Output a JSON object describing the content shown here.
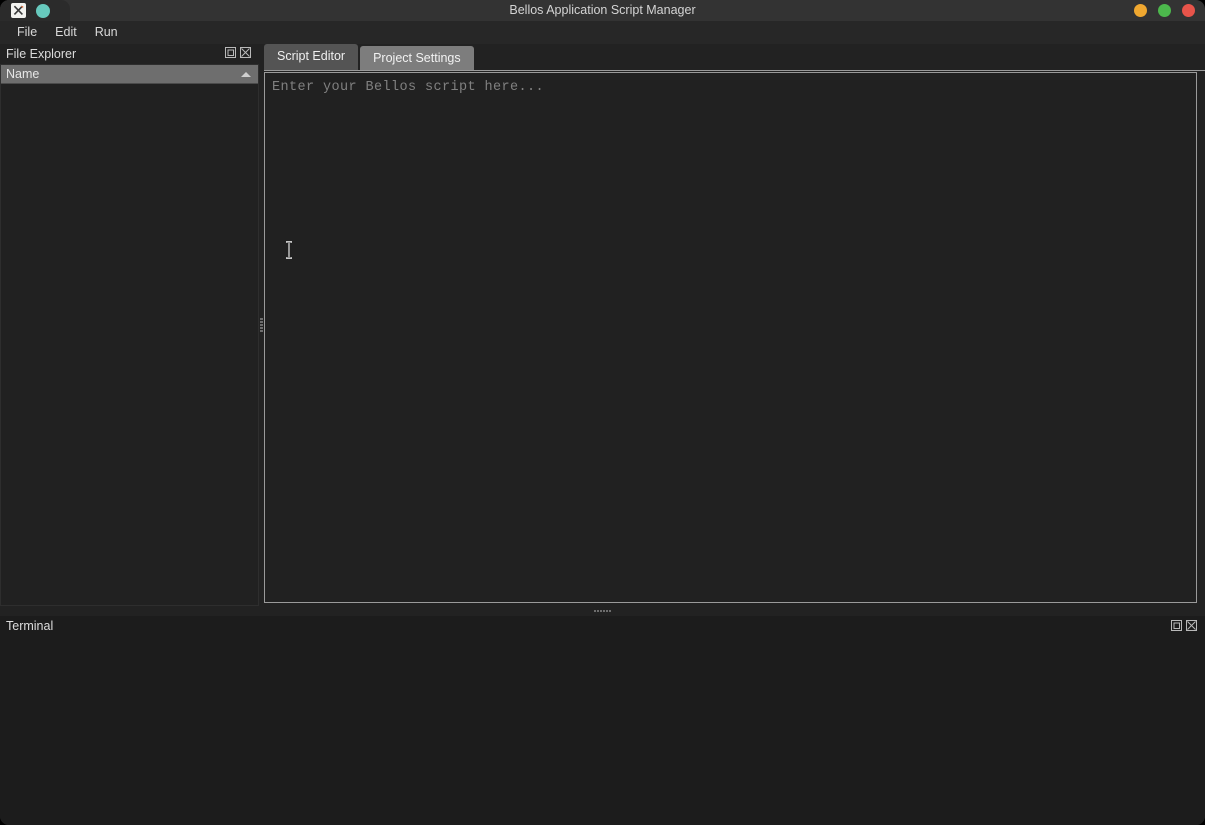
{
  "window": {
    "title": "Bellos Application Script Manager",
    "app_icon": "app-x-icon",
    "status_dot": "teal-status-dot",
    "controls": [
      {
        "name": "minimize-button",
        "color": "#f0a830"
      },
      {
        "name": "maximize-button",
        "color": "#4cb84c"
      },
      {
        "name": "close-button",
        "color": "#e8544a"
      }
    ],
    "colors": {
      "titlebar": "#333333",
      "menubar": "#272727",
      "body": "#222222",
      "panel": "#212121",
      "terminal": "#1c1c1c",
      "tab_active": "#545454",
      "tab_inactive": "#7d7d7d",
      "column_header": "#6e6e6e",
      "text": "#d9d9d9",
      "placeholder": "#808080",
      "border": "#9a9a9a"
    }
  },
  "menubar": {
    "items": [
      {
        "label": "File"
      },
      {
        "label": "Edit"
      },
      {
        "label": "Run"
      }
    ]
  },
  "file_explorer": {
    "title": "File Explorer",
    "float_button_label": "float-panel",
    "close_button_label": "close-panel",
    "columns": [
      {
        "label": "Name",
        "sort": "ascending"
      }
    ],
    "rows": []
  },
  "editor_panel": {
    "tabs": [
      {
        "label": "Script Editor",
        "active": true
      },
      {
        "label": "Project Settings",
        "active": false
      }
    ],
    "editor": {
      "value": "",
      "placeholder": "Enter your Bellos script here..."
    }
  },
  "terminal": {
    "title": "Terminal",
    "float_button_label": "float-panel",
    "close_button_label": "close-panel",
    "output": ""
  },
  "splitters": {
    "vertical_label": "vertical-splitter",
    "horizontal_label": "horizontal-splitter"
  }
}
